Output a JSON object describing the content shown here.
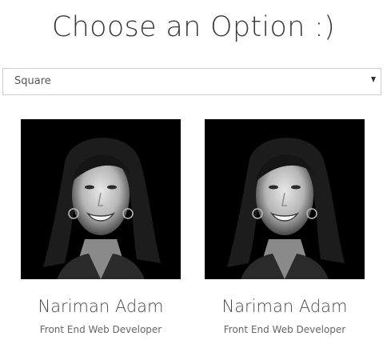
{
  "header": {
    "title": "Choose an Option :)"
  },
  "shape_select": {
    "selected": "Square",
    "icon": "chevron-down-icon"
  },
  "cards": [
    {
      "name": "Nariman Adam",
      "role": "Front End Web Developer",
      "photo": "portrait-photo"
    },
    {
      "name": "Nariman Adam",
      "role": "Front End Web Developer",
      "photo": "portrait-photo"
    }
  ]
}
